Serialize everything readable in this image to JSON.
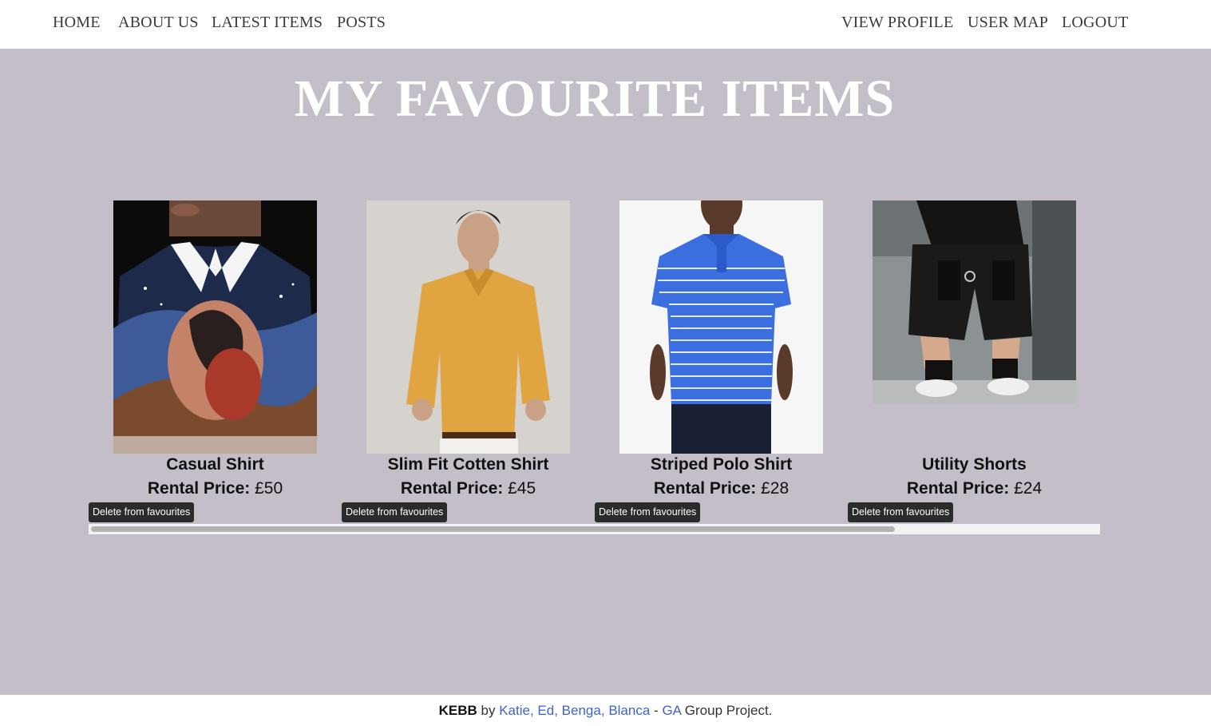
{
  "nav": {
    "home": "HOME",
    "about": "ABOUT US",
    "latest": "LATEST ITEMS",
    "posts": "POSTS",
    "profile": "VIEW PROFILE",
    "map": "USER MAP",
    "logout": "LOGOUT"
  },
  "page": {
    "title": "MY FAVOURITE ITEMS"
  },
  "items": [
    {
      "name": "Casual Shirt",
      "price_label": "Rental Price:",
      "price": "£50",
      "button": "Delete from favourites"
    },
    {
      "name": "Slim Fit Cotten Shirt",
      "price_label": "Rental Price:",
      "price": "£45",
      "button": "Delete from favourites"
    },
    {
      "name": "Striped Polo Shirt",
      "price_label": "Rental Price:",
      "price": "£28",
      "button": "Delete from favourites"
    },
    {
      "name": "Utility Shorts",
      "price_label": "Rental Price:",
      "price": "£24",
      "button": "Delete from favourites"
    }
  ],
  "footer": {
    "brand": "KEBB",
    "by": "by",
    "authors": [
      "Katie",
      "Ed",
      "Benga",
      "Blanca"
    ],
    "dash": "-",
    "ga": "GA",
    "suffix": "Group Project."
  },
  "colors": {
    "page_bg": "#c3bec7",
    "link": "#3f63c9",
    "button_bg": "#2b2b2b"
  }
}
